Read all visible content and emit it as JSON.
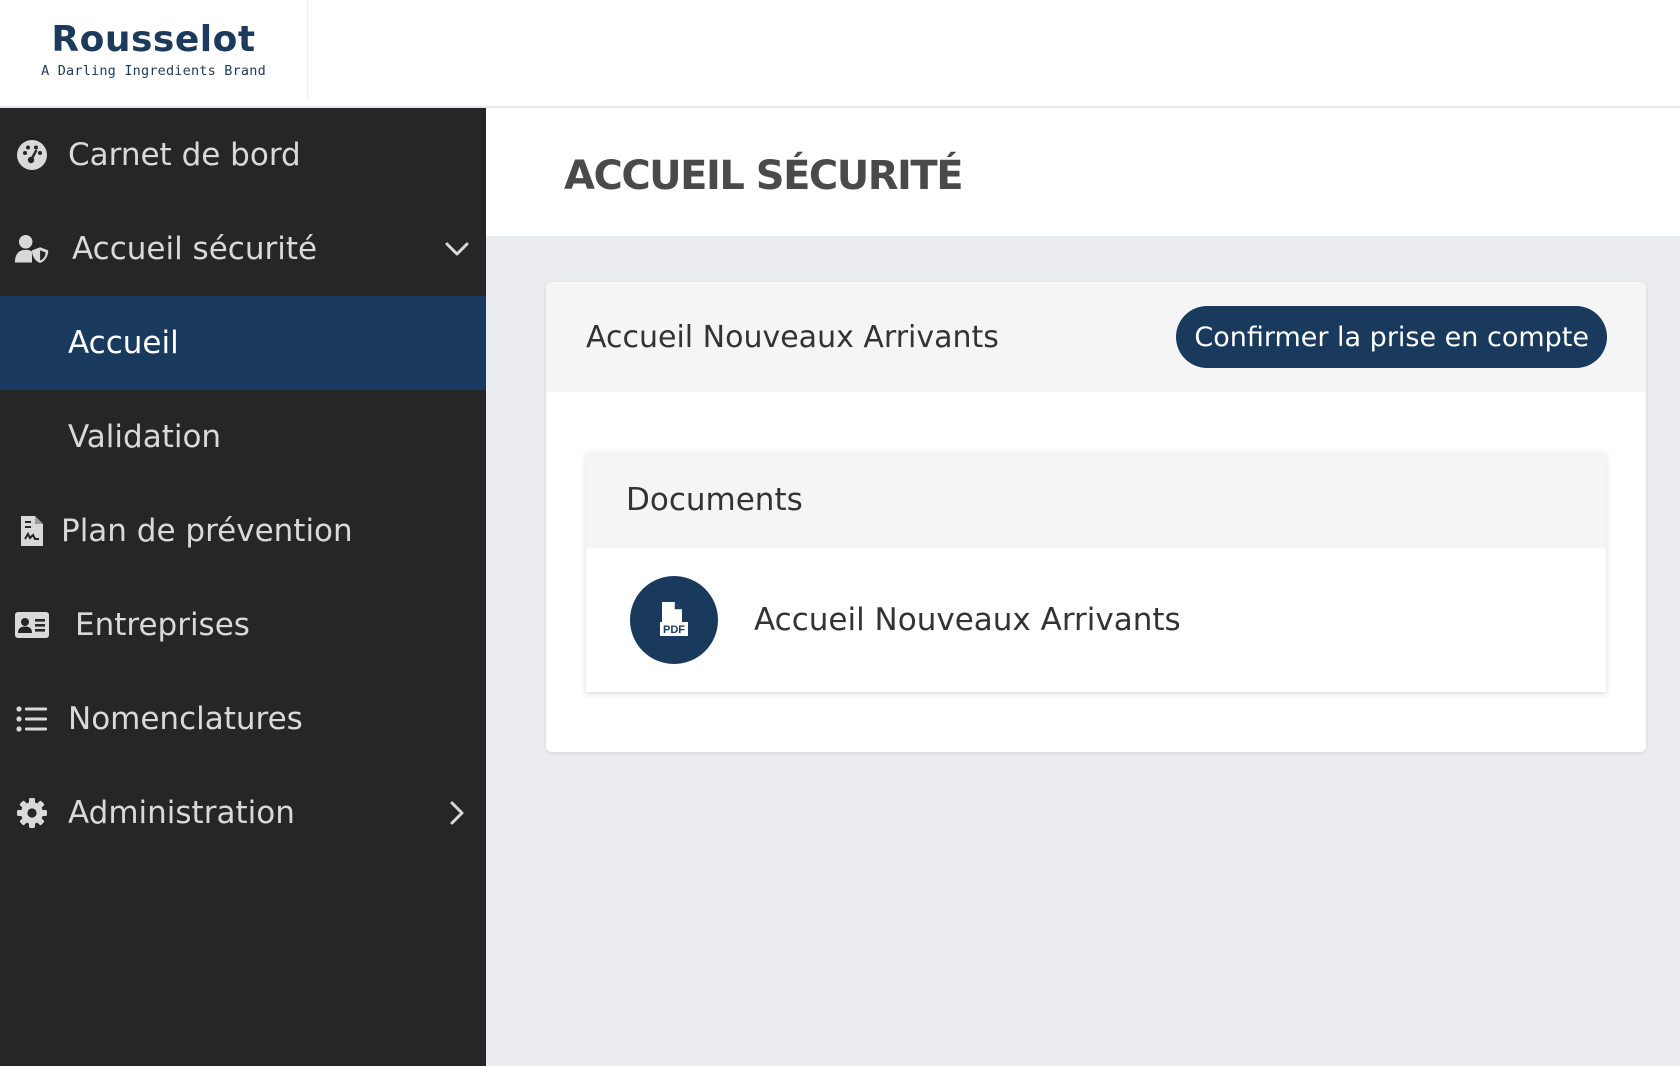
{
  "brand": {
    "name": "Rousselot",
    "tagline": "A Darling Ingredients Brand",
    "color": "#1b3a5c"
  },
  "sidebar": {
    "items": [
      {
        "label": "Carnet de bord",
        "icon": "dashboard-icon"
      },
      {
        "label": "Accueil sécurité",
        "icon": "user-shield-icon",
        "expanded": true,
        "children": [
          {
            "label": "Accueil",
            "active": true
          },
          {
            "label": "Validation",
            "active": false
          }
        ]
      },
      {
        "label": "Plan de prévention",
        "icon": "file-signature-icon"
      },
      {
        "label": "Entreprises",
        "icon": "id-card-icon"
      },
      {
        "label": "Nomenclatures",
        "icon": "list-icon"
      },
      {
        "label": "Administration",
        "icon": "gear-icon",
        "expanded": false
      }
    ]
  },
  "page": {
    "title": "ACCUEIL SÉCURITÉ"
  },
  "card": {
    "title": "Accueil Nouveaux Arrivants",
    "confirm_label": "Confirmer la prise en compte",
    "documents": {
      "title": "Documents",
      "items": [
        {
          "name": "Accueil Nouveaux Arrivants",
          "icon": "pdf-file-icon"
        }
      ]
    }
  },
  "colors": {
    "sidebar_bg": "#262626",
    "accent": "#193a5c",
    "content_bg": "#ebecf0"
  }
}
